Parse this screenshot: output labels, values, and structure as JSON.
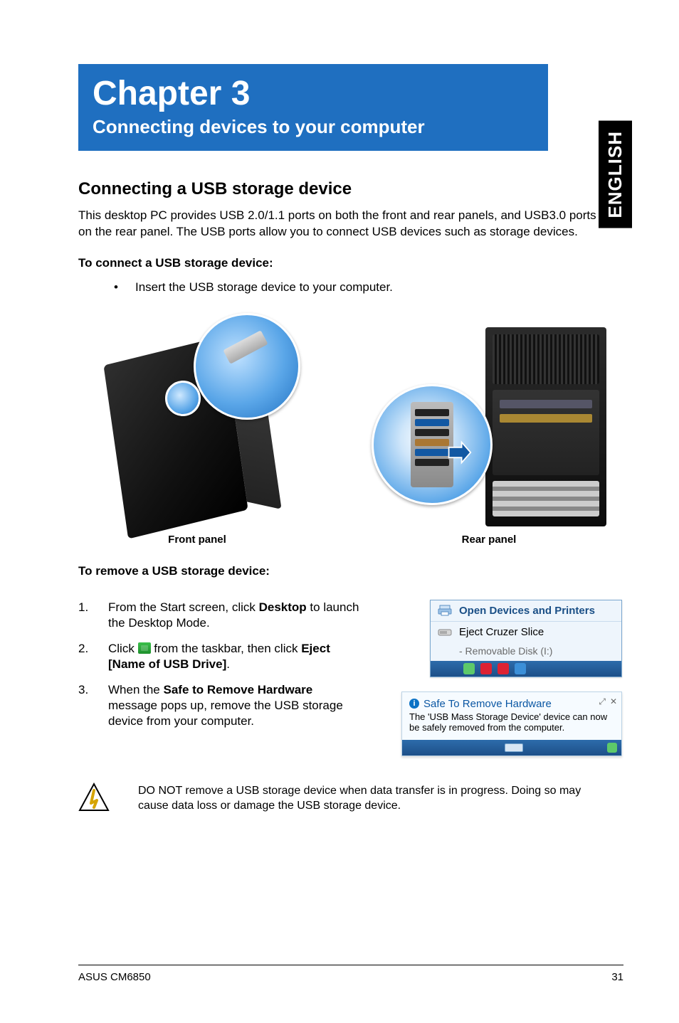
{
  "side_tab": "ENGLISH",
  "chapter": {
    "title": "Chapter 3",
    "subtitle": "Connecting devices to your computer"
  },
  "section1": {
    "heading": "Connecting a USB storage device",
    "intro": "This desktop PC provides USB 2.0/1.1 ports on both the front and rear panels, and USB3.0 ports on the rear panel. The USB ports allow you to connect USB devices such as storage devices.",
    "connect_heading": "To connect a USB storage device:",
    "connect_bullet": "Insert the USB storage device to your computer.",
    "front_caption": "Front panel",
    "rear_caption": "Rear panel"
  },
  "remove": {
    "heading": "To remove a USB storage device:",
    "steps": [
      {
        "num": "1.",
        "pre": "From the Start screen, click ",
        "b1": "Desktop",
        "post1": " to launch the Desktop Mode."
      },
      {
        "num": "2.",
        "pre": "Click ",
        "icon": true,
        "mid": " from the taskbar, then click ",
        "b1": "Eject [Name of USB Drive]",
        "post1": "."
      },
      {
        "num": "3.",
        "pre": "When the ",
        "b1": "Safe to Remove Hardware",
        "post1": " message pops up, remove the USB storage device from your computer."
      }
    ]
  },
  "win_menu": {
    "open_devices": "Open Devices and Printers",
    "eject_label": "Eject Cruzer Slice",
    "removable": "-   Removable Disk (I:)"
  },
  "toast": {
    "title": "Safe To Remove Hardware",
    "body": "The 'USB Mass Storage Device' device can now be safely removed from the computer."
  },
  "warning": "DO NOT remove a USB storage device when data transfer is in progress. Doing so may cause data loss or damage the USB storage device.",
  "footer": {
    "left": "ASUS CM6850",
    "right": "31"
  }
}
